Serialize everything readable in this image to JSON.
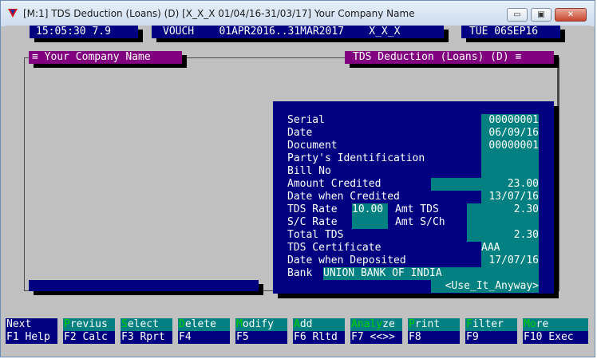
{
  "window": {
    "title": "[M:1]  TDS Deduction (Loans) (D)  [X_X_X  01/04/16-31/03/17]  Your Company Name",
    "min_glyph": "▭",
    "max_glyph": "▣",
    "close_glyph": "✕"
  },
  "status": {
    "clock": "15:05:30 7.9",
    "mode": "VOUCH    01APR2016..31MAR2017    X_X_X",
    "date": "TUE 06SEP16"
  },
  "frame": {
    "left_title": "≡ Your Company Name",
    "right_title": "TDS Deduction (Loans) (D) ≡"
  },
  "form": {
    "labels": {
      "serial": "Serial",
      "date": "Date",
      "document": "Document",
      "party": "Party's Identification",
      "bill_no": "Bill No",
      "amount_credited": "Amount Credited",
      "date_credited": "Date when Credited",
      "tds_rate": "TDS Rate",
      "amt_tds": "Amt TDS",
      "sc_rate": "S/C Rate",
      "amt_sch": "Amt S/Ch",
      "total_tds": "Total TDS",
      "tds_certificate": "TDS Certificate",
      "date_deposited": "Date when Deposited",
      "bank": "Bank"
    },
    "values": {
      "serial": "00000001",
      "date": "06/09/16",
      "document": "00000001",
      "party": "",
      "bill_no": "",
      "amount_credited": "23.00",
      "date_credited": "13/07/16",
      "tds_rate": "10.00",
      "amt_tds": "2.30",
      "sc_rate": "",
      "amt_sch": "",
      "total_tds": "2.30",
      "tds_certificate": "AAA",
      "date_deposited": "17/07/16",
      "bank": "UNION BANK OF INDIA"
    },
    "use_anyway": "<Use_It_Anyway>"
  },
  "fkeys": [
    {
      "hot": "",
      "rest": "Next",
      "bottom": "F1 Help"
    },
    {
      "hot": "P",
      "rest": "revius",
      "bottom": "F2 Calc"
    },
    {
      "hot": "S",
      "rest": "elect",
      "bottom": "F3 Rprt"
    },
    {
      "hot": "D",
      "rest": "elete",
      "bottom": "F4"
    },
    {
      "hot": "M",
      "rest": "odify",
      "bottom": "F5"
    },
    {
      "hot": "A",
      "rest": "dd",
      "bottom": "F6 Rltd"
    },
    {
      "hot": "Analy",
      "rest": "ze",
      "bottom": "F7 <<>>"
    },
    {
      "hot": "P",
      "rest": "rint",
      "bottom": "F8"
    },
    {
      "hot": "F",
      "rest": "ilter",
      "bottom": "F9"
    },
    {
      "hot": "Mo",
      "rest": "re",
      "bottom": "F10 Exec"
    }
  ]
}
